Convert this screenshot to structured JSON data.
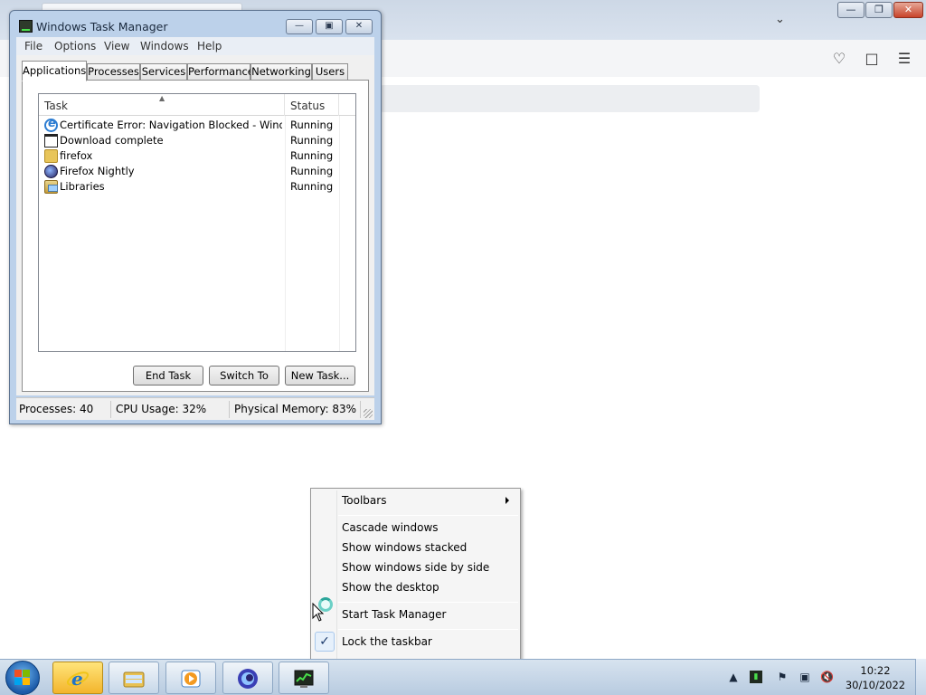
{
  "task_manager": {
    "title": "Windows Task Manager",
    "menu": [
      "File",
      "Options",
      "View",
      "Windows",
      "Help"
    ],
    "tabs": [
      "Applications",
      "Processes",
      "Services",
      "Performance",
      "Networking",
      "Users"
    ],
    "active_tab": "Applications",
    "columns": {
      "task": "Task",
      "status": "Status"
    },
    "rows": [
      {
        "task": "Certificate Error: Navigation Blocked - Windows ...",
        "status": "Running",
        "icon": "internet-explorer-icon"
      },
      {
        "task": "Download complete",
        "status": "Running",
        "icon": "window-icon"
      },
      {
        "task": "firefox",
        "status": "Running",
        "icon": "folder-icon"
      },
      {
        "task": "Firefox Nightly",
        "status": "Running",
        "icon": "firefox-nightly-icon"
      },
      {
        "task": "Libraries",
        "status": "Running",
        "icon": "libraries-icon"
      }
    ],
    "buttons": {
      "end_task": "End Task",
      "switch_to": "Switch To",
      "new_task": "New Task..."
    },
    "status_bar": {
      "processes": "Processes: 40",
      "cpu": "CPU Usage: 32%",
      "memory": "Physical Memory: 83%"
    }
  },
  "context_menu": {
    "items": [
      {
        "label": "Toolbars",
        "submenu": true
      },
      {
        "label": "Cascade windows"
      },
      {
        "label": "Show windows stacked"
      },
      {
        "label": "Show windows side by side"
      },
      {
        "label": "Show the desktop"
      },
      {
        "label": "Start Task Manager"
      },
      {
        "label": "Lock the taskbar",
        "checked": true
      }
    ]
  },
  "taskbar": {
    "pinned": [
      "internet-explorer-icon",
      "windows-explorer-icon",
      "media-player-icon",
      "firefox-icon",
      "task-manager-icon"
    ],
    "clock": {
      "time": "10:22",
      "date": "30/10/2022"
    }
  },
  "colors": {
    "window_frame": "#bcd1ea",
    "taskbar": "#b8cbe0",
    "active_taskbar_button": "#f3b52c"
  }
}
